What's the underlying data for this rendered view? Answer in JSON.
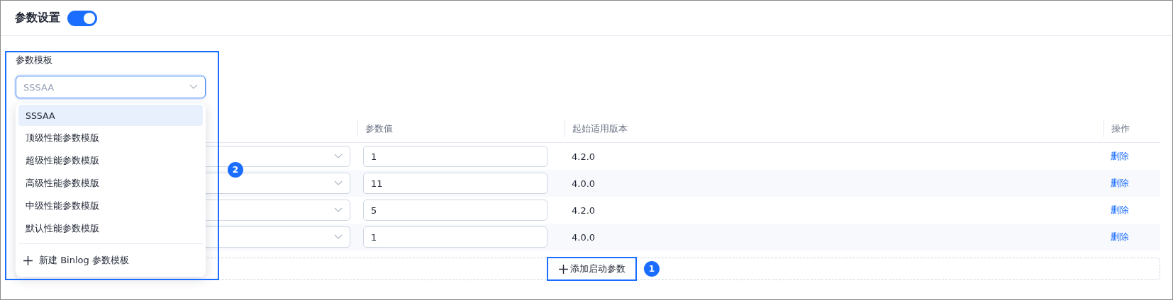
{
  "header": {
    "title": "参数设置",
    "toggle_on": true
  },
  "template": {
    "label": "参数模板",
    "placeholder": "SSSAA",
    "open": true,
    "highlighted": true,
    "badge": "2",
    "options": [
      {
        "label": "SSSAA",
        "selected": true
      },
      {
        "label": "顶级性能参数模版",
        "selected": false
      },
      {
        "label": "超级性能参数模版",
        "selected": false
      },
      {
        "label": "高级性能参数模版",
        "selected": false
      },
      {
        "label": "中级性能参数模版",
        "selected": false
      },
      {
        "label": "默认性能参数模版",
        "selected": false
      }
    ],
    "create_label": "新建 Binlog 参数模板"
  },
  "table": {
    "columns": [
      "参数值",
      "起始适用版本",
      "操作"
    ],
    "rows": [
      {
        "value": "1",
        "version": "4.2.0",
        "action": "删除"
      },
      {
        "value": "11",
        "version": "4.0.0",
        "action": "删除"
      },
      {
        "value": "5",
        "version": "4.2.0",
        "action": "删除"
      },
      {
        "value": "1",
        "version": "4.0.0",
        "action": "删除"
      }
    ]
  },
  "add_button": {
    "label": "添加启动参数",
    "highlighted": true,
    "badge": "1"
  }
}
